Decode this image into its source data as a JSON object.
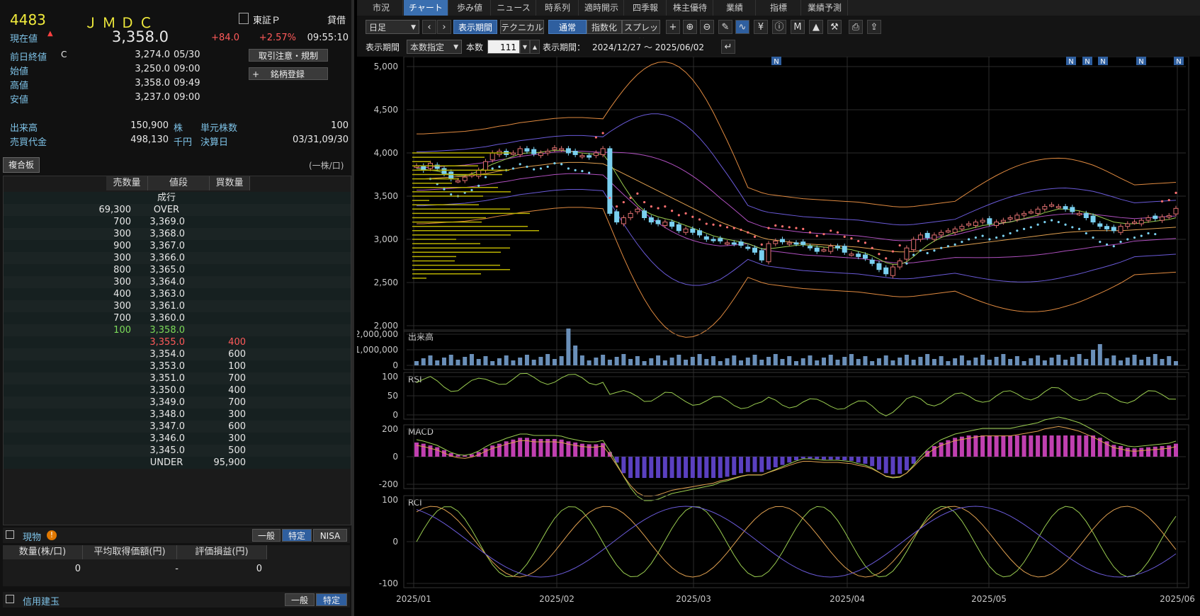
{
  "stock": {
    "code": "4483",
    "name": "ＪＭＤＣ",
    "market": "東証Ｐ",
    "lending": "貸借",
    "current_label": "現在値",
    "current_price": "3,358.0",
    "change": "+84.0",
    "change_pct": "+2.57%",
    "time": "09:55:10",
    "prev_close_label": "前日終値",
    "prev_close_flag": "C",
    "prev_close": "3,274.0",
    "prev_close_date": "05/30",
    "open_label": "始値",
    "open": "3,250.0",
    "open_time": "09:00",
    "high_label": "高値",
    "high": "3,358.0",
    "high_time": "09:49",
    "low_label": "安値",
    "low": "3,237.0",
    "low_time": "09:00",
    "volume_label": "出来高",
    "volume": "150,900",
    "volume_unit": "株",
    "unit_shares_label": "単元株数",
    "unit_shares": "100",
    "turnover_label": "売買代金",
    "turnover": "498,130",
    "turnover_unit": "千円",
    "fiscal_label": "決算日",
    "fiscal": "03/31,09/30",
    "btn_caution": "取引注意・規制",
    "btn_register": "銘柄登録",
    "btn_register_plus": "+"
  },
  "board": {
    "tab": "複合板",
    "unit_note": "(一株/口)",
    "headers": [
      "売数量",
      "値段",
      "買数量"
    ],
    "rows": [
      {
        "sell": "",
        "price": "成行",
        "buy": ""
      },
      {
        "sell": "69,300",
        "price": "OVER",
        "buy": ""
      },
      {
        "sell": "700",
        "price": "3,369.0",
        "buy": ""
      },
      {
        "sell": "300",
        "price": "3,368.0",
        "buy": ""
      },
      {
        "sell": "900",
        "price": "3,367.0",
        "buy": ""
      },
      {
        "sell": "300",
        "price": "3,366.0",
        "buy": ""
      },
      {
        "sell": "800",
        "price": "3,365.0",
        "buy": ""
      },
      {
        "sell": "300",
        "price": "3,364.0",
        "buy": ""
      },
      {
        "sell": "400",
        "price": "3,363.0",
        "buy": ""
      },
      {
        "sell": "300",
        "price": "3,361.0",
        "buy": ""
      },
      {
        "sell": "700",
        "price": "3,360.0",
        "buy": ""
      },
      {
        "sell": "100",
        "price": "3,358.0",
        "buy": ""
      },
      {
        "sell": "",
        "price": "3,355.0",
        "buy": "400"
      },
      {
        "sell": "",
        "price": "3,354.0",
        "buy": "600"
      },
      {
        "sell": "",
        "price": "3,353.0",
        "buy": "100"
      },
      {
        "sell": "",
        "price": "3,351.0",
        "buy": "700"
      },
      {
        "sell": "",
        "price": "3,350.0",
        "buy": "400"
      },
      {
        "sell": "",
        "price": "3,349.0",
        "buy": "700"
      },
      {
        "sell": "",
        "price": "3,348.0",
        "buy": "300"
      },
      {
        "sell": "",
        "price": "3,347.0",
        "buy": "600"
      },
      {
        "sell": "",
        "price": "3,346.0",
        "buy": "300"
      },
      {
        "sell": "",
        "price": "3,345.0",
        "buy": "500"
      },
      {
        "sell": "",
        "price": "UNDER",
        "buy": "95,900"
      }
    ]
  },
  "holdings": {
    "title": "現物",
    "tabs": [
      "一般",
      "特定",
      "NISA"
    ],
    "headers": [
      "数量(株/口)",
      "平均取得価額(円)",
      "評価損益(円)"
    ],
    "values": [
      "0",
      "-",
      "0"
    ]
  },
  "margin": {
    "title": "信用建玉",
    "tabs": [
      "一般",
      "特定"
    ]
  },
  "top_tabs": [
    "市況",
    "チャート",
    "歩み値",
    "ニュース",
    "時系列",
    "適時開示",
    "四季報",
    "株主優待",
    "業績",
    "指標",
    "業績予測"
  ],
  "toolbar": {
    "period_select": "日足",
    "display_period": "表示期間",
    "technical": "テクニカル",
    "normal": "通常",
    "index": "指数化",
    "spread": "スプレッド",
    "period_label": "表示期間",
    "period_mode": "本数指定",
    "count_label": "本数",
    "count": "111",
    "range_label": "表示期間：",
    "range": "2024/12/27 ～ 2025/06/02",
    "icons": [
      "plus-icon",
      "zoom-in-icon",
      "zoom-out-icon",
      "pencil-icon",
      "trend-icon",
      "yen-icon",
      "info-icon",
      "my-icon",
      "area-icon",
      "wrench-icon",
      "print-icon",
      "export-icon"
    ]
  },
  "chart_data": {
    "type": "line",
    "title": "",
    "price_axis": [
      5000,
      4500,
      4000,
      3500,
      3000,
      2500,
      2000
    ],
    "price_axis_labels": [
      "5,000",
      "4,500",
      "4,000",
      "3,500",
      "3,000",
      "2,500",
      "2,000"
    ],
    "x_labels": [
      "2025/01",
      "2025/02",
      "2025/03",
      "2025/04",
      "2025/05",
      "2025/06"
    ],
    "news_markers": [
      "N",
      "N",
      "N",
      "N",
      "N",
      "N"
    ],
    "close": [
      3850,
      3800,
      3880,
      3820,
      3760,
      3700,
      3680,
      3720,
      3750,
      3800,
      3900,
      4000,
      4020,
      3980,
      4000,
      4050,
      4020,
      3990,
      4000,
      4020,
      4060,
      4050,
      4000,
      3980,
      3970,
      3950,
      4000,
      4050,
      3300,
      3200,
      3250,
      3300,
      3350,
      3250,
      3200,
      3180,
      3200,
      3150,
      3100,
      3120,
      3080,
      3050,
      3000,
      2990,
      2980,
      2960,
      2950,
      2930,
      2900,
      2850,
      2760,
      2950,
      2980,
      2970,
      2960,
      2950,
      2940,
      2900,
      2860,
      2880,
      2920,
      2900,
      2850,
      2830,
      2800,
      2780,
      2720,
      2650,
      2600,
      2680,
      2750,
      2900,
      3000,
      3050,
      3020,
      3050,
      3080,
      3100,
      3120,
      3150,
      3180,
      3200,
      3220,
      3180,
      3200,
      3220,
      3250,
      3280,
      3300,
      3320,
      3350,
      3380,
      3400,
      3380,
      3350,
      3320,
      3300,
      3250,
      3200,
      3150,
      3120,
      3100,
      3150,
      3180,
      3200,
      3220,
      3250,
      3240,
      3260,
      3274,
      3358
    ],
    "ma_short": [
      3820,
      3810,
      3800,
      3790,
      3770,
      3750,
      3740,
      3740,
      3760,
      3790,
      3830,
      3870,
      3900,
      3930,
      3960,
      3990,
      4000,
      4000,
      4010,
      4020,
      4030,
      4030,
      4020,
      4010,
      4000,
      3990,
      3985,
      3990,
      3880,
      3750,
      3620,
      3500,
      3400,
      3330,
      3290,
      3260,
      3240,
      3220,
      3190,
      3160,
      3130,
      3100,
      3070,
      3040,
      3020,
      3000,
      2985,
      2970,
      2950,
      2920,
      2890,
      2890,
      2900,
      2910,
      2920,
      2930,
      2935,
      2930,
      2920,
      2910,
      2905,
      2900,
      2890,
      2880,
      2860,
      2840,
      2810,
      2770,
      2730,
      2710,
      2710,
      2740,
      2800,
      2870,
      2930,
      2980,
      3020,
      3050,
      3080,
      3100,
      3120,
      3140,
      3160,
      3170,
      3180,
      3190,
      3200,
      3220,
      3240,
      3260,
      3280,
      3310,
      3330,
      3350,
      3350,
      3340,
      3330,
      3310,
      3290,
      3260,
      3230,
      3200,
      3190,
      3180,
      3180,
      3190,
      3200,
      3210,
      3220,
      3230,
      3250
    ],
    "ma_long": [
      3700,
      3700,
      3705,
      3710,
      3715,
      3720,
      3725,
      3730,
      3740,
      3750,
      3760,
      3775,
      3790,
      3800,
      3815,
      3830,
      3840,
      3850,
      3860,
      3870,
      3880,
      3885,
      3890,
      3890,
      3890,
      3885,
      3880,
      3875,
      3840,
      3800,
      3760,
      3720,
      3680,
      3640,
      3600,
      3560,
      3520,
      3480,
      3440,
      3400,
      3360,
      3320,
      3280,
      3240,
      3200,
      3170,
      3140,
      3110,
      3080,
      3050,
      3020,
      3000,
      2990,
      2980,
      2970,
      2960,
      2950,
      2945,
      2940,
      2935,
      2930,
      2925,
      2920,
      2915,
      2910,
      2900,
      2890,
      2880,
      2870,
      2860,
      2855,
      2855,
      2860,
      2870,
      2880,
      2890,
      2900,
      2910,
      2920,
      2930,
      2940,
      2950,
      2960,
      2970,
      2980,
      2990,
      3000,
      3010,
      3020,
      3030,
      3040,
      3050,
      3060,
      3070,
      3080,
      3085,
      3090,
      3095,
      3100,
      3100,
      3100,
      3100,
      3100,
      3105,
      3110,
      3115,
      3120,
      3125,
      3130,
      3135,
      3140
    ],
    "volume_axis": [
      "2,000,000",
      "1,000,000",
      "0"
    ],
    "volume_label": "出来高",
    "rsi_label": "RSI",
    "rsi_axis": [
      "100",
      "50",
      "0"
    ],
    "macd_label": "MACD",
    "macd_axis": [
      "200",
      "0",
      "-200"
    ],
    "rci_label": "RCI",
    "rci_axis": [
      "100",
      "0",
      "-100"
    ]
  },
  "colors": {
    "up": "#e07070",
    "down": "#7ad0f0",
    "accent_blue": "#3a6fb0",
    "green": "#7cdc5a",
    "red": "#ff5a5a",
    "yellow": "#f0f000"
  }
}
